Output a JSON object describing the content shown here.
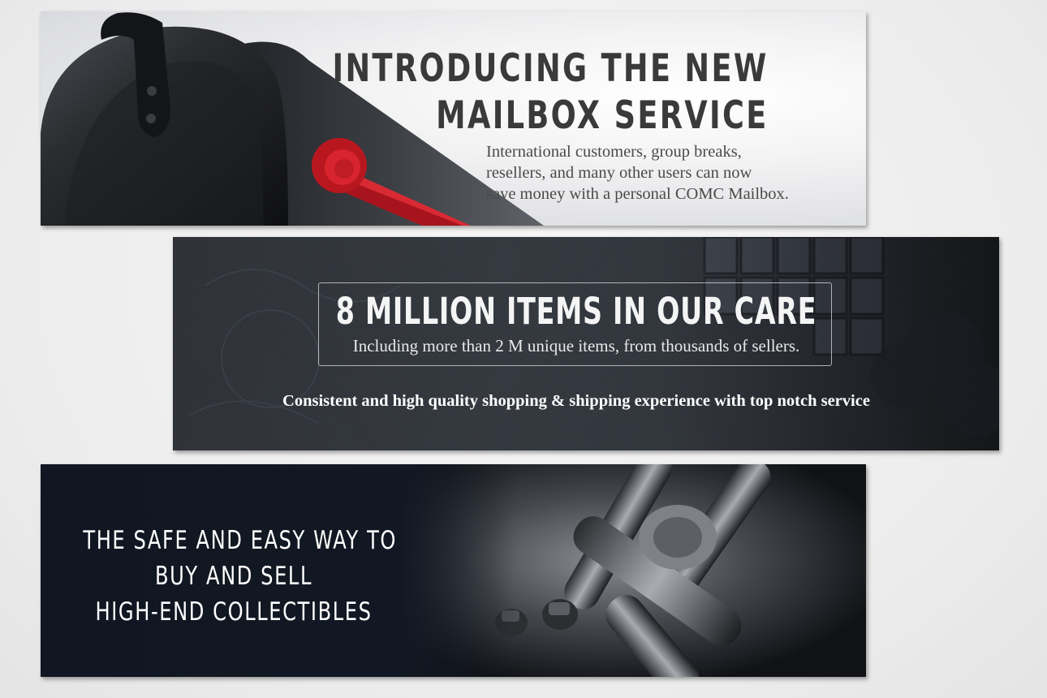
{
  "banners": [
    {
      "headline": [
        "INTRODUCING THE NEW",
        "MAILBOX SERVICE"
      ],
      "body": [
        "International customers, group breaks,",
        "resellers, and many other users can now",
        "save money with a personal COMC Mailbox."
      ],
      "accent": "#c8202a"
    },
    {
      "headline": "8 MILLION ITEMS IN OUR CARE",
      "subheadline": "Including more than 2 M unique items, from thousands of sellers.",
      "tagline": "Consistent and high quality shopping & shipping experience with top notch service"
    },
    {
      "lines": [
        "THE SAFE AND EASY WAY TO",
        "BUY AND SELL",
        "HIGH-END COLLECTIBLES"
      ]
    }
  ]
}
